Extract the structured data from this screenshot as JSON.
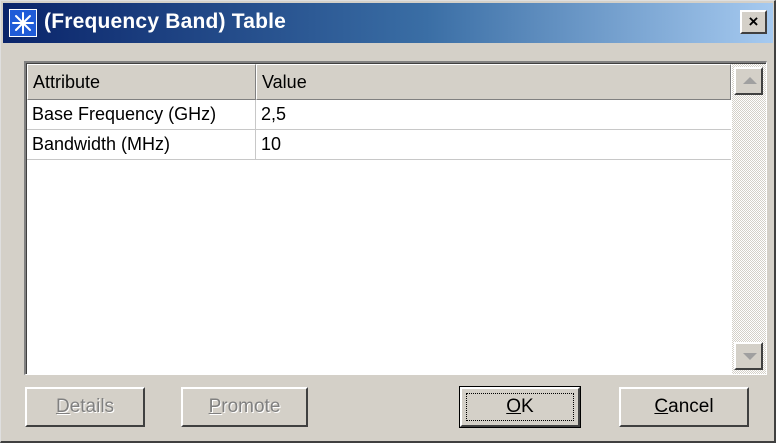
{
  "window": {
    "title": "(Frequency Band) Table",
    "app_icon": "starburst-icon",
    "close_label": "×"
  },
  "table": {
    "columns": [
      "Attribute",
      "Value"
    ],
    "rows": [
      {
        "attribute": "Base Frequency (GHz)",
        "value": "2,5"
      },
      {
        "attribute": "Bandwidth (MHz)",
        "value": "10"
      }
    ]
  },
  "buttons": {
    "details": {
      "accel": "D",
      "rest": "etails",
      "enabled": false
    },
    "promote": {
      "accel": "P",
      "rest": "romote",
      "enabled": false
    },
    "ok": {
      "accel": "O",
      "rest": "K",
      "enabled": true
    },
    "cancel": {
      "accel": "C",
      "rest": "ancel",
      "enabled": true
    }
  },
  "colors": {
    "titlebar_start": "#0a246a",
    "titlebar_end": "#a6caf0",
    "face": "#d4d0c8"
  }
}
